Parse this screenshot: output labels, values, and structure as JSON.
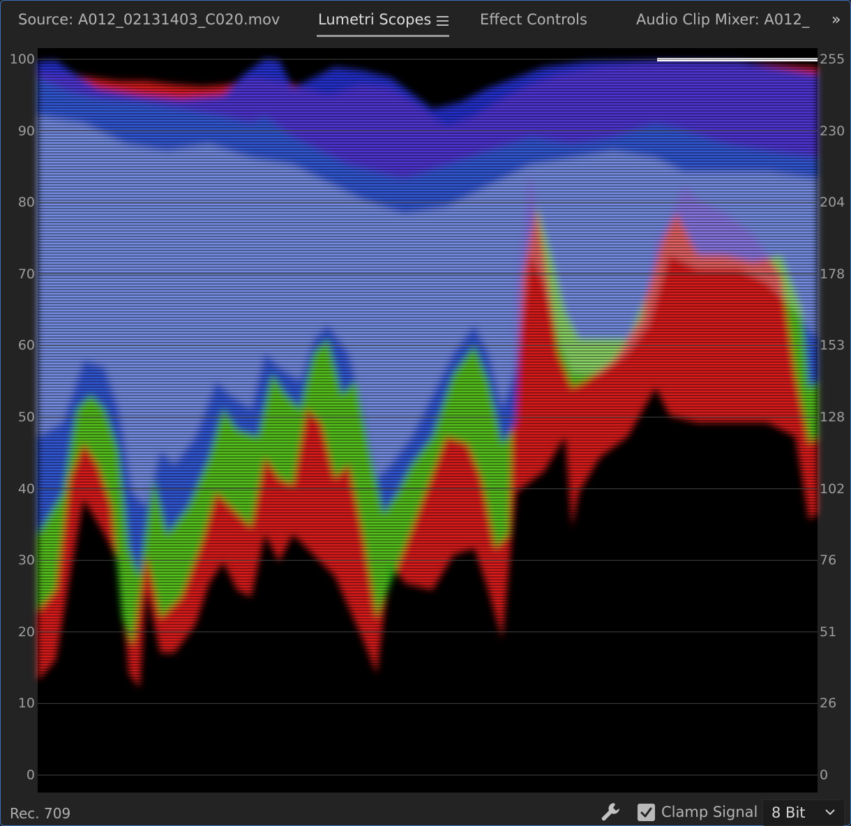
{
  "tabs": [
    {
      "label": "Source: A012_02131403_C020.mov",
      "active": false
    },
    {
      "label": "Lumetri Scopes",
      "active": true
    },
    {
      "label": "Effect Controls",
      "active": false
    },
    {
      "label": "Audio Clip Mixer: A012_",
      "active": false
    }
  ],
  "icons": {
    "panel_menu": "hamburger-menu-icon",
    "overflow": "double-chevron-right-icon",
    "settings": "wrench-icon",
    "checkbox": "checkmark-icon",
    "dropdown": "chevron-down-icon"
  },
  "scope": {
    "type": "RGB parade / waveform",
    "left_scale": [
      "100",
      "90",
      "80",
      "70",
      "60",
      "50",
      "40",
      "30",
      "20",
      "10",
      "0"
    ],
    "right_scale": [
      "255",
      "230",
      "204",
      "178",
      "153",
      "128",
      "102",
      "76",
      "51",
      "26",
      "0"
    ],
    "colors": {
      "red": "#ff1e1e",
      "green": "#20ff20",
      "blue": "#2a3cff",
      "background": "#000000",
      "grid": "#444444"
    }
  },
  "footer": {
    "color_space": "Rec. 709",
    "clamp_label": "Clamp Signal",
    "clamp_checked": true,
    "bit_depth": "8 Bit"
  }
}
